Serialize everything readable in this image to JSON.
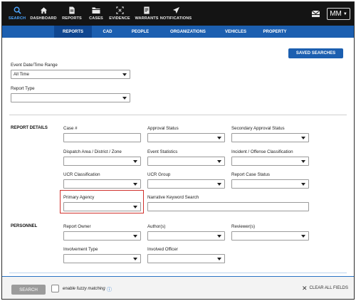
{
  "nav": {
    "items": [
      {
        "label": "SEARCH",
        "icon": "search-icon"
      },
      {
        "label": "DASHBOARD",
        "icon": "home-icon"
      },
      {
        "label": "REPORTS",
        "icon": "document-icon"
      },
      {
        "label": "CASES",
        "icon": "folder-icon"
      },
      {
        "label": "EVIDENCE",
        "icon": "evidence-icon"
      },
      {
        "label": "WARRANTS",
        "icon": "warrant-icon"
      },
      {
        "label": "NOTIFICATIONS",
        "icon": "send-icon"
      }
    ],
    "user_initials": "MM",
    "accent": "#4ea6ff"
  },
  "subtabs": [
    "REPORTS",
    "CAD",
    "PEOPLE",
    "ORGANIZATIONS",
    "VEHICLES",
    "PROPERTY"
  ],
  "saved_searches_label": "SAVED SEARCHES",
  "filters": {
    "event_date_label": "Event Date/Time Range",
    "event_date_value": "All Time",
    "report_type_label": "Report Type"
  },
  "report_details": {
    "section_label": "REPORT DETAILS",
    "fields": {
      "case_number": "Case #",
      "approval_status": "Approval Status",
      "secondary_approval_status": "Secondary Approval Status",
      "dispatch_area": "Dispatch Area / District / Zone",
      "event_statistics": "Event Statistics",
      "incident_offense": "Incident / Offense Classification",
      "ucr_classification": "UCR Classification",
      "ucr_group": "UCR Group",
      "report_case_status": "Report Case Status",
      "primary_agency": "Primary Agency",
      "narrative_keyword": "Narrative Keyword Search"
    }
  },
  "personnel": {
    "section_label": "PERSONNEL",
    "fields": {
      "report_owner": "Report Owner",
      "authors": "Author(s)",
      "reviewers": "Reviewer(s)",
      "involvement_type": "Involvement Type",
      "involved_officer": "Involved Officer"
    }
  },
  "bottom": {
    "search_label": "SEARCH",
    "fuzzy_label": "enable fuzzy matching",
    "clear_label": "CLEAR ALL FIELDS"
  },
  "colors": {
    "nav_bg": "#141414",
    "tab_bar": "#1c5fb0",
    "tab_active": "#0f4690",
    "highlight": "#d0302b"
  }
}
